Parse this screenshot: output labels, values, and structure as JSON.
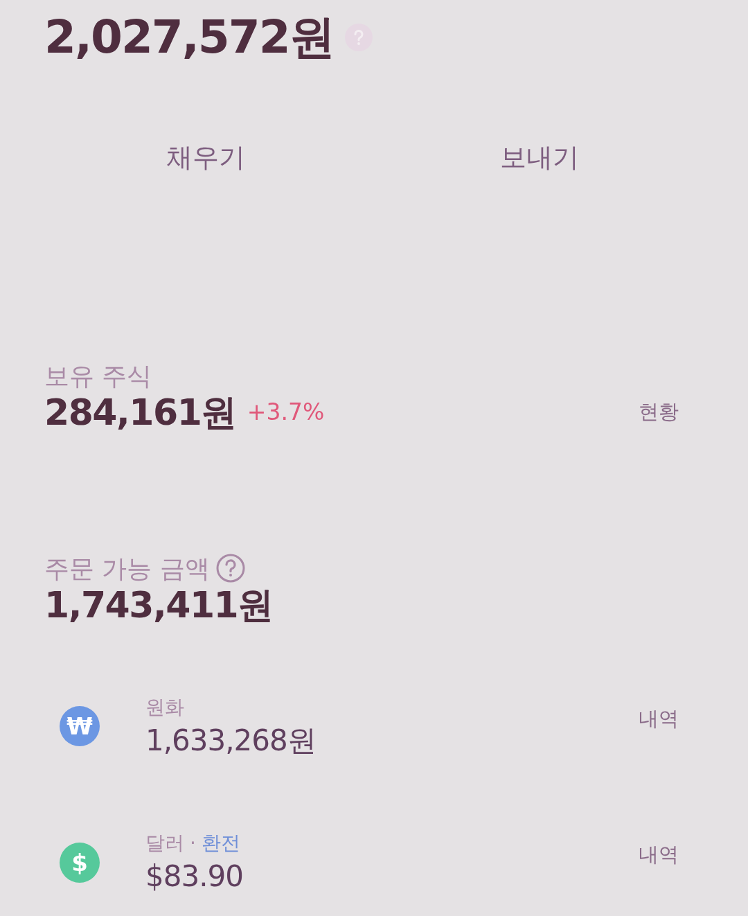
{
  "total": {
    "amount": "2,027,572원"
  },
  "actions": [
    {
      "label": "채우기"
    },
    {
      "label": "보내기"
    }
  ],
  "holdings": {
    "title": "보유 주식",
    "amount": "284,161원",
    "change": "+3.7%",
    "link": "현황"
  },
  "orderable": {
    "title": "주문 가능 금액",
    "amount": "1,743,411원"
  },
  "accounts": [
    {
      "symbol": "₩",
      "color": "#6c97e3",
      "name": "원화",
      "amount": "1,633,268원",
      "link": "내역"
    },
    {
      "symbol": "$",
      "color": "#56c99b",
      "name": "달러",
      "separator": "·",
      "exchange": "환전",
      "amount": "$83.90",
      "link": "내역"
    }
  ]
}
